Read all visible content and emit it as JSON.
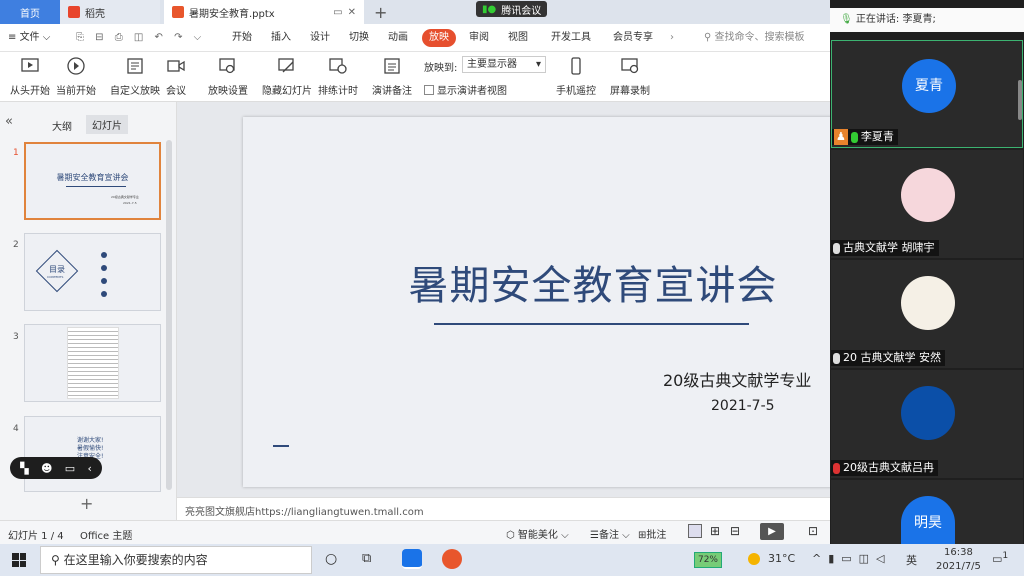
{
  "tabs": {
    "home": "首页",
    "daoke": "稻壳",
    "file": "暑期安全教育.pptx",
    "tencent": "腾讯会议"
  },
  "menu": {
    "file": "文件",
    "items": [
      "开始",
      "插入",
      "设计",
      "切换",
      "动画",
      "放映",
      "审阅",
      "视图",
      "开发工具",
      "会员专享"
    ],
    "more": "⌄",
    "search": "查找命令、搜索模板"
  },
  "ribbon": {
    "from_start": "从头开始",
    "from_current": "当前开始",
    "custom": "自定义放映",
    "meeting": "会议",
    "show_settings": "放映设置",
    "hide_slide": "隐藏幻灯片",
    "rehearse": "排练计时",
    "presenter_notes": "演讲备注",
    "play_to_label": "放映到:",
    "play_to_value": "主要显示器",
    "presenter_view": "显示演讲者视图",
    "phone_remote": "手机遥控",
    "screen_record": "屏幕录制"
  },
  "panel": {
    "outline_tab": "大纲",
    "slides_tab": "幻灯片",
    "numbers": [
      "1",
      "2",
      "3",
      "4"
    ],
    "add": "+"
  },
  "thumbs": {
    "t1_title": "暑期安全教育宣讲会",
    "t1_sub": "20级古典文献学专业",
    "t1_date": "2021-7-5",
    "t2_title": "目录",
    "t2_sub": "CONTENTS",
    "t4_lines": [
      "谢谢大家!",
      "暑假愉快!",
      "注意安全!"
    ]
  },
  "slide": {
    "title": "暑期安全教育宣讲会",
    "subtitle": "20级古典文献学专业",
    "date": "2021-7-5"
  },
  "notes": "亮亮图文旗舰店https://liangliangtuwen.tmall.com",
  "status": {
    "slide_count": "幻灯片 1 / 4",
    "theme": "Office 主题",
    "smart": "智能美化",
    "notes": "备注",
    "comments": "批注"
  },
  "meeting": {
    "speaking": "正在讲话: 李夏青;",
    "participants": [
      {
        "avatar_text": "夏青",
        "name": "李夏青"
      },
      {
        "avatar_text": "",
        "name": "古典文献学 胡啸宇"
      },
      {
        "avatar_text": "",
        "name": "20 古典文献学 安然"
      },
      {
        "avatar_text": "",
        "name": "20级古典文献吕冉"
      },
      {
        "avatar_text": "明昊",
        "name": ""
      }
    ]
  },
  "taskbar": {
    "search": "在这里输入你要搜索的内容",
    "battery": "72%",
    "weather": "31°C",
    "ime": "英",
    "time": "16:38",
    "date": "2021/7/5",
    "notif": "1"
  },
  "colors": {
    "accent": "#e64f2e",
    "slide_text": "#2f4a7a",
    "avatar_blue": "#1a73e8"
  }
}
